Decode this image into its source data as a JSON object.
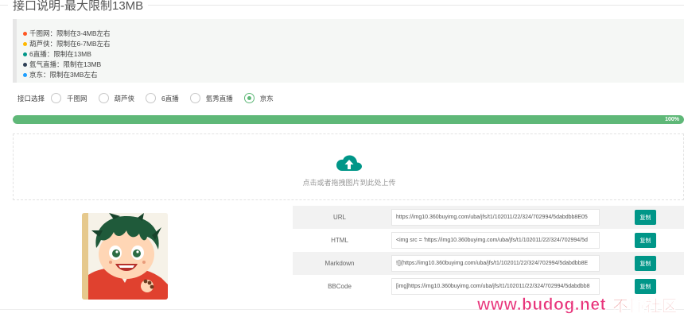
{
  "header": {
    "title": "接口说明-最大限制13MB"
  },
  "notice": {
    "items": [
      {
        "text": "千图网：限制在3-4MB左右",
        "color": "#ff5722"
      },
      {
        "text": "葫芦侠：限制在6-7MB左右",
        "color": "#ffb800"
      },
      {
        "text": "6直播：限制在13MB",
        "color": "#009688"
      },
      {
        "text": "氩气直播：限制在13MB",
        "color": "#2f4056"
      },
      {
        "text": "京东：限制在3MB左右",
        "color": "#1e9fff"
      }
    ]
  },
  "interface": {
    "label": "接口选择",
    "options": [
      {
        "label": "千图网",
        "checked": false
      },
      {
        "label": "葫芦侠",
        "checked": false
      },
      {
        "label": "6直播",
        "checked": false
      },
      {
        "label": "氩秀直播",
        "checked": false
      },
      {
        "label": "京东",
        "checked": true
      }
    ]
  },
  "progress": {
    "value": 100,
    "text": "100%"
  },
  "upload": {
    "text": "点击或者拖拽图片到此处上传",
    "icon": "cloud-upload-icon"
  },
  "links": [
    {
      "label": "URL",
      "value": "https://img10.360buyimg.com/uba/jfs/t1/102011/22/324/702994/5dabdbb8E05",
      "copy": "复制"
    },
    {
      "label": "HTML",
      "value": "<img src = 'https://img10.360buyimg.com/uba/jfs/t1/102011/22/324/702994/5d",
      "copy": "复制"
    },
    {
      "label": "Markdown",
      "value": "![](https://img10.360buyimg.com/uba/jfs/t1/102011/22/324/702994/5dabdbb8E",
      "copy": "复制"
    },
    {
      "label": "BBCode",
      "value": "[img]https://img10.360buyimg.com/uba/jfs/t1/102011/22/324/702994/5dabdbb8",
      "copy": "复制"
    }
  ],
  "watermark": {
    "url": "www.budog.net",
    "cn": "不懂社区"
  }
}
